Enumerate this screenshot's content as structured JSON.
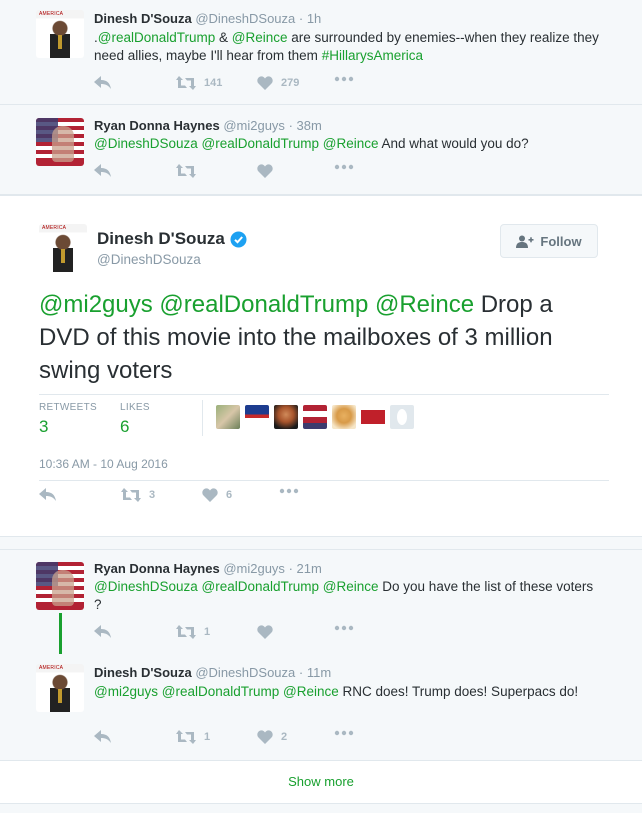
{
  "tweets_above": [
    {
      "name": "Dinesh D'Souza",
      "handle": "@DineshDSouza",
      "time": "· 1h",
      "text_parts": [
        ".",
        "@realDonaldTrump",
        " & ",
        "@Reince",
        " are surrounded by enemies--when they realize they need allies, maybe I'll hear from them ",
        "#HillarysAmerica"
      ],
      "retweets": "141",
      "likes": "279"
    },
    {
      "name": "Ryan Donna Haynes",
      "handle": "@mi2guys",
      "time": "· 38m",
      "text_parts": [
        "@DineshDSouza",
        " ",
        "@realDonaldTrump",
        " ",
        "@Reince",
        " And what would you do?"
      ],
      "retweets": "",
      "likes": ""
    }
  ],
  "main_tweet": {
    "name": "Dinesh D'Souza",
    "handle": "@DineshDSouza",
    "verified": true,
    "follow_label": "Follow",
    "text_parts": [
      "@mi2guys",
      " ",
      "@realDonaldTrump",
      " ",
      "@Reince",
      " Drop a DVD of this movie into the mailboxes of 3 million swing voters"
    ],
    "retweets_label": "RETWEETS",
    "retweets": "3",
    "likes_label": "LIKES",
    "likes": "6",
    "timestamp": "10:36 AM - 10 Aug 2016",
    "action_retweets": "3",
    "action_likes": "6"
  },
  "replies": [
    {
      "name": "Ryan Donna Haynes",
      "handle": "@mi2guys",
      "time": "· 21m",
      "text_parts": [
        "@DineshDSouza",
        " ",
        "@realDonaldTrump",
        " ",
        "@Reince",
        " Do you have the list of these voters ?"
      ],
      "retweets": "1",
      "likes": ""
    },
    {
      "name": "Dinesh D'Souza",
      "handle": "@DineshDSouza",
      "time": "· 11m",
      "text_parts": [
        "@mi2guys",
        " ",
        "@realDonaldTrump",
        " ",
        "@Reince",
        " RNC does! Trump does! Superpacs do!"
      ],
      "retweets": "1",
      "likes": "2"
    }
  ],
  "show_more": "Show more",
  "colors": {
    "link": "#19a02f",
    "muted": "#8899a6",
    "icon": "#aab8c2"
  },
  "icons": [
    "reply-icon",
    "retweet-icon",
    "heart-icon",
    "more-icon",
    "verified-icon",
    "follow-person-icon"
  ]
}
